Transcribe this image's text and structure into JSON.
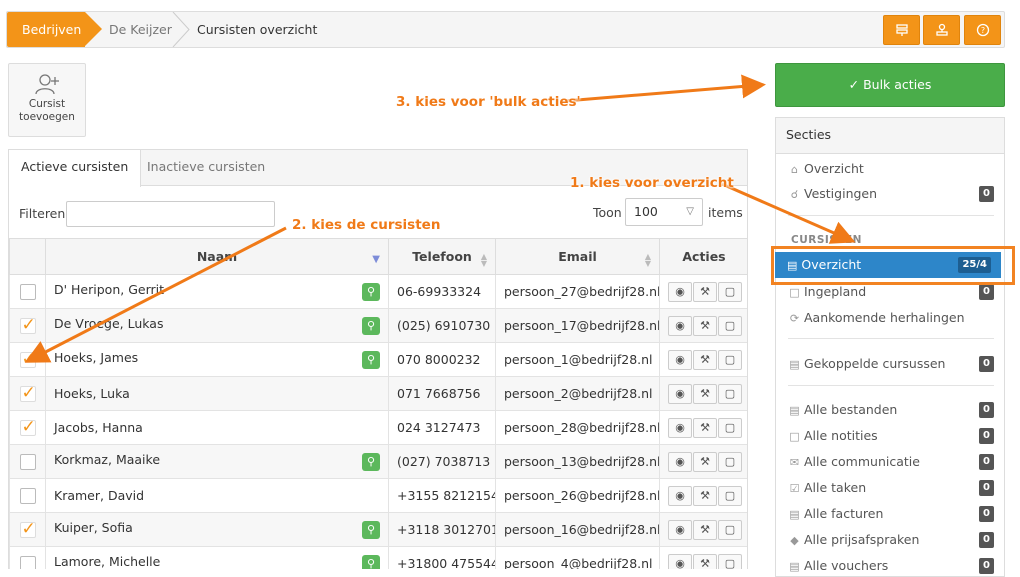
{
  "breadcrumb": {
    "items": [
      "Bedrijven",
      "De Keijzer",
      "Cursisten overzicht"
    ]
  },
  "toolbar": {
    "icons": [
      "list-icon",
      "stamp-icon",
      "help-icon"
    ]
  },
  "add_button": {
    "line1": "Cursist",
    "line2": "toevoegen"
  },
  "tabs": {
    "active": "Actieve cursisten",
    "inactive": "Inactieve cursisten"
  },
  "filter": {
    "label": "Filteren",
    "value": ""
  },
  "pagesize": {
    "label": "Toon",
    "value": "100",
    "suffix": "items"
  },
  "table": {
    "headers": [
      "Naam",
      "Telefoon",
      "Email",
      "Acties"
    ],
    "rows": [
      {
        "checked": false,
        "name": "D' Heripon, Gerrit",
        "key": true,
        "phone": "06-69933324",
        "email": "persoon_27@bedrijf28.nl"
      },
      {
        "checked": true,
        "name": "De Vroege, Lukas",
        "key": true,
        "phone": "(025) 6910730",
        "email": "persoon_17@bedrijf28.nl"
      },
      {
        "checked": true,
        "name": "Hoeks, James",
        "key": true,
        "phone": "070 8000232",
        "email": "persoon_1@bedrijf28.nl"
      },
      {
        "checked": true,
        "name": "Hoeks, Luka",
        "key": false,
        "phone": "071 7668756",
        "email": "persoon_2@bedrijf28.nl"
      },
      {
        "checked": true,
        "name": "Jacobs, Hanna",
        "key": false,
        "phone": "024 3127473",
        "email": "persoon_28@bedrijf28.nl"
      },
      {
        "checked": false,
        "name": "Korkmaz, Maaike",
        "key": true,
        "phone": "(027) 7038713",
        "email": "persoon_13@bedrijf28.nl"
      },
      {
        "checked": false,
        "name": "Kramer, David",
        "key": false,
        "phone": "+3155 8212154",
        "email": "persoon_26@bedrijf28.nl"
      },
      {
        "checked": true,
        "name": "Kuiper, Sofia",
        "key": true,
        "phone": "+3118 3012701",
        "email": "persoon_16@bedrijf28.nl"
      },
      {
        "checked": false,
        "name": "Lamore, Michelle",
        "key": true,
        "phone": "+31800 475544",
        "email": "persoon_4@bedrijf28.nl"
      }
    ]
  },
  "bulk_button": "Bulk acties",
  "sidebar": {
    "title": "Secties",
    "top": [
      {
        "label": "Overzicht",
        "badge": ""
      },
      {
        "label": "Vestigingen",
        "badge": "0"
      }
    ],
    "subhead": "CURSISTEN",
    "active": {
      "label": "Overzicht",
      "badge": "25/4"
    },
    "cursisten": [
      {
        "label": "Ingepland",
        "badge": "0"
      },
      {
        "label": "Aankomende herhalingen",
        "badge": ""
      }
    ],
    "gekoppeld": {
      "label": "Gekoppelde cursussen",
      "badge": "0"
    },
    "alle": [
      {
        "label": "Alle bestanden",
        "badge": "0"
      },
      {
        "label": "Alle notities",
        "badge": "0"
      },
      {
        "label": "Alle communicatie",
        "badge": "0"
      },
      {
        "label": "Alle taken",
        "badge": "0"
      },
      {
        "label": "Alle facturen",
        "badge": "0"
      },
      {
        "label": "Alle prijsafspraken",
        "badge": "0"
      },
      {
        "label": "Alle vouchers",
        "badge": "0"
      }
    ]
  },
  "annotations": {
    "step1": "1. kies voor overzicht",
    "step2": "2. kies de cursisten",
    "step3": "3. kies voor 'bulk acties'"
  },
  "colors": {
    "accent": "#f39418",
    "success": "#4aad4a",
    "active": "#2d86c9",
    "annotation": "#f07a18"
  }
}
